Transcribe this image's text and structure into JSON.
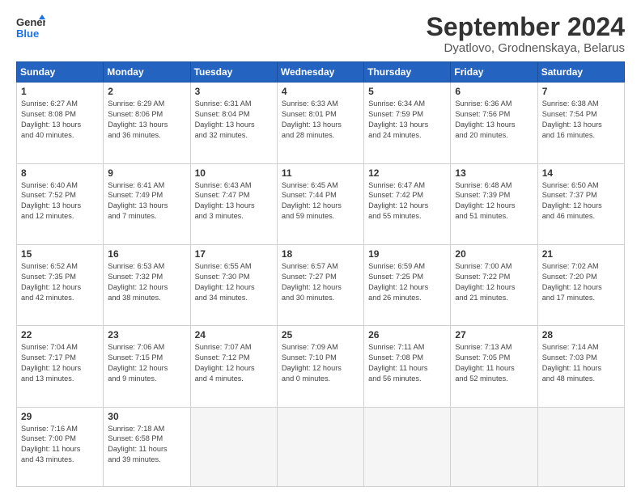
{
  "header": {
    "logo_line1": "General",
    "logo_line2": "Blue",
    "title": "September 2024",
    "subtitle": "Dyatlovo, Grodnenskaya, Belarus"
  },
  "weekdays": [
    "Sunday",
    "Monday",
    "Tuesday",
    "Wednesday",
    "Thursday",
    "Friday",
    "Saturday"
  ],
  "weeks": [
    [
      {
        "day": "1",
        "info": "Sunrise: 6:27 AM\nSunset: 8:08 PM\nDaylight: 13 hours\nand 40 minutes."
      },
      {
        "day": "2",
        "info": "Sunrise: 6:29 AM\nSunset: 8:06 PM\nDaylight: 13 hours\nand 36 minutes."
      },
      {
        "day": "3",
        "info": "Sunrise: 6:31 AM\nSunset: 8:04 PM\nDaylight: 13 hours\nand 32 minutes."
      },
      {
        "day": "4",
        "info": "Sunrise: 6:33 AM\nSunset: 8:01 PM\nDaylight: 13 hours\nand 28 minutes."
      },
      {
        "day": "5",
        "info": "Sunrise: 6:34 AM\nSunset: 7:59 PM\nDaylight: 13 hours\nand 24 minutes."
      },
      {
        "day": "6",
        "info": "Sunrise: 6:36 AM\nSunset: 7:56 PM\nDaylight: 13 hours\nand 20 minutes."
      },
      {
        "day": "7",
        "info": "Sunrise: 6:38 AM\nSunset: 7:54 PM\nDaylight: 13 hours\nand 16 minutes."
      }
    ],
    [
      {
        "day": "8",
        "info": "Sunrise: 6:40 AM\nSunset: 7:52 PM\nDaylight: 13 hours\nand 12 minutes."
      },
      {
        "day": "9",
        "info": "Sunrise: 6:41 AM\nSunset: 7:49 PM\nDaylight: 13 hours\nand 7 minutes."
      },
      {
        "day": "10",
        "info": "Sunrise: 6:43 AM\nSunset: 7:47 PM\nDaylight: 13 hours\nand 3 minutes."
      },
      {
        "day": "11",
        "info": "Sunrise: 6:45 AM\nSunset: 7:44 PM\nDaylight: 12 hours\nand 59 minutes."
      },
      {
        "day": "12",
        "info": "Sunrise: 6:47 AM\nSunset: 7:42 PM\nDaylight: 12 hours\nand 55 minutes."
      },
      {
        "day": "13",
        "info": "Sunrise: 6:48 AM\nSunset: 7:39 PM\nDaylight: 12 hours\nand 51 minutes."
      },
      {
        "day": "14",
        "info": "Sunrise: 6:50 AM\nSunset: 7:37 PM\nDaylight: 12 hours\nand 46 minutes."
      }
    ],
    [
      {
        "day": "15",
        "info": "Sunrise: 6:52 AM\nSunset: 7:35 PM\nDaylight: 12 hours\nand 42 minutes."
      },
      {
        "day": "16",
        "info": "Sunrise: 6:53 AM\nSunset: 7:32 PM\nDaylight: 12 hours\nand 38 minutes."
      },
      {
        "day": "17",
        "info": "Sunrise: 6:55 AM\nSunset: 7:30 PM\nDaylight: 12 hours\nand 34 minutes."
      },
      {
        "day": "18",
        "info": "Sunrise: 6:57 AM\nSunset: 7:27 PM\nDaylight: 12 hours\nand 30 minutes."
      },
      {
        "day": "19",
        "info": "Sunrise: 6:59 AM\nSunset: 7:25 PM\nDaylight: 12 hours\nand 26 minutes."
      },
      {
        "day": "20",
        "info": "Sunrise: 7:00 AM\nSunset: 7:22 PM\nDaylight: 12 hours\nand 21 minutes."
      },
      {
        "day": "21",
        "info": "Sunrise: 7:02 AM\nSunset: 7:20 PM\nDaylight: 12 hours\nand 17 minutes."
      }
    ],
    [
      {
        "day": "22",
        "info": "Sunrise: 7:04 AM\nSunset: 7:17 PM\nDaylight: 12 hours\nand 13 minutes."
      },
      {
        "day": "23",
        "info": "Sunrise: 7:06 AM\nSunset: 7:15 PM\nDaylight: 12 hours\nand 9 minutes."
      },
      {
        "day": "24",
        "info": "Sunrise: 7:07 AM\nSunset: 7:12 PM\nDaylight: 12 hours\nand 4 minutes."
      },
      {
        "day": "25",
        "info": "Sunrise: 7:09 AM\nSunset: 7:10 PM\nDaylight: 12 hours\nand 0 minutes."
      },
      {
        "day": "26",
        "info": "Sunrise: 7:11 AM\nSunset: 7:08 PM\nDaylight: 11 hours\nand 56 minutes."
      },
      {
        "day": "27",
        "info": "Sunrise: 7:13 AM\nSunset: 7:05 PM\nDaylight: 11 hours\nand 52 minutes."
      },
      {
        "day": "28",
        "info": "Sunrise: 7:14 AM\nSunset: 7:03 PM\nDaylight: 11 hours\nand 48 minutes."
      }
    ],
    [
      {
        "day": "29",
        "info": "Sunrise: 7:16 AM\nSunset: 7:00 PM\nDaylight: 11 hours\nand 43 minutes."
      },
      {
        "day": "30",
        "info": "Sunrise: 7:18 AM\nSunset: 6:58 PM\nDaylight: 11 hours\nand 39 minutes."
      },
      {
        "day": "",
        "info": ""
      },
      {
        "day": "",
        "info": ""
      },
      {
        "day": "",
        "info": ""
      },
      {
        "day": "",
        "info": ""
      },
      {
        "day": "",
        "info": ""
      }
    ]
  ]
}
